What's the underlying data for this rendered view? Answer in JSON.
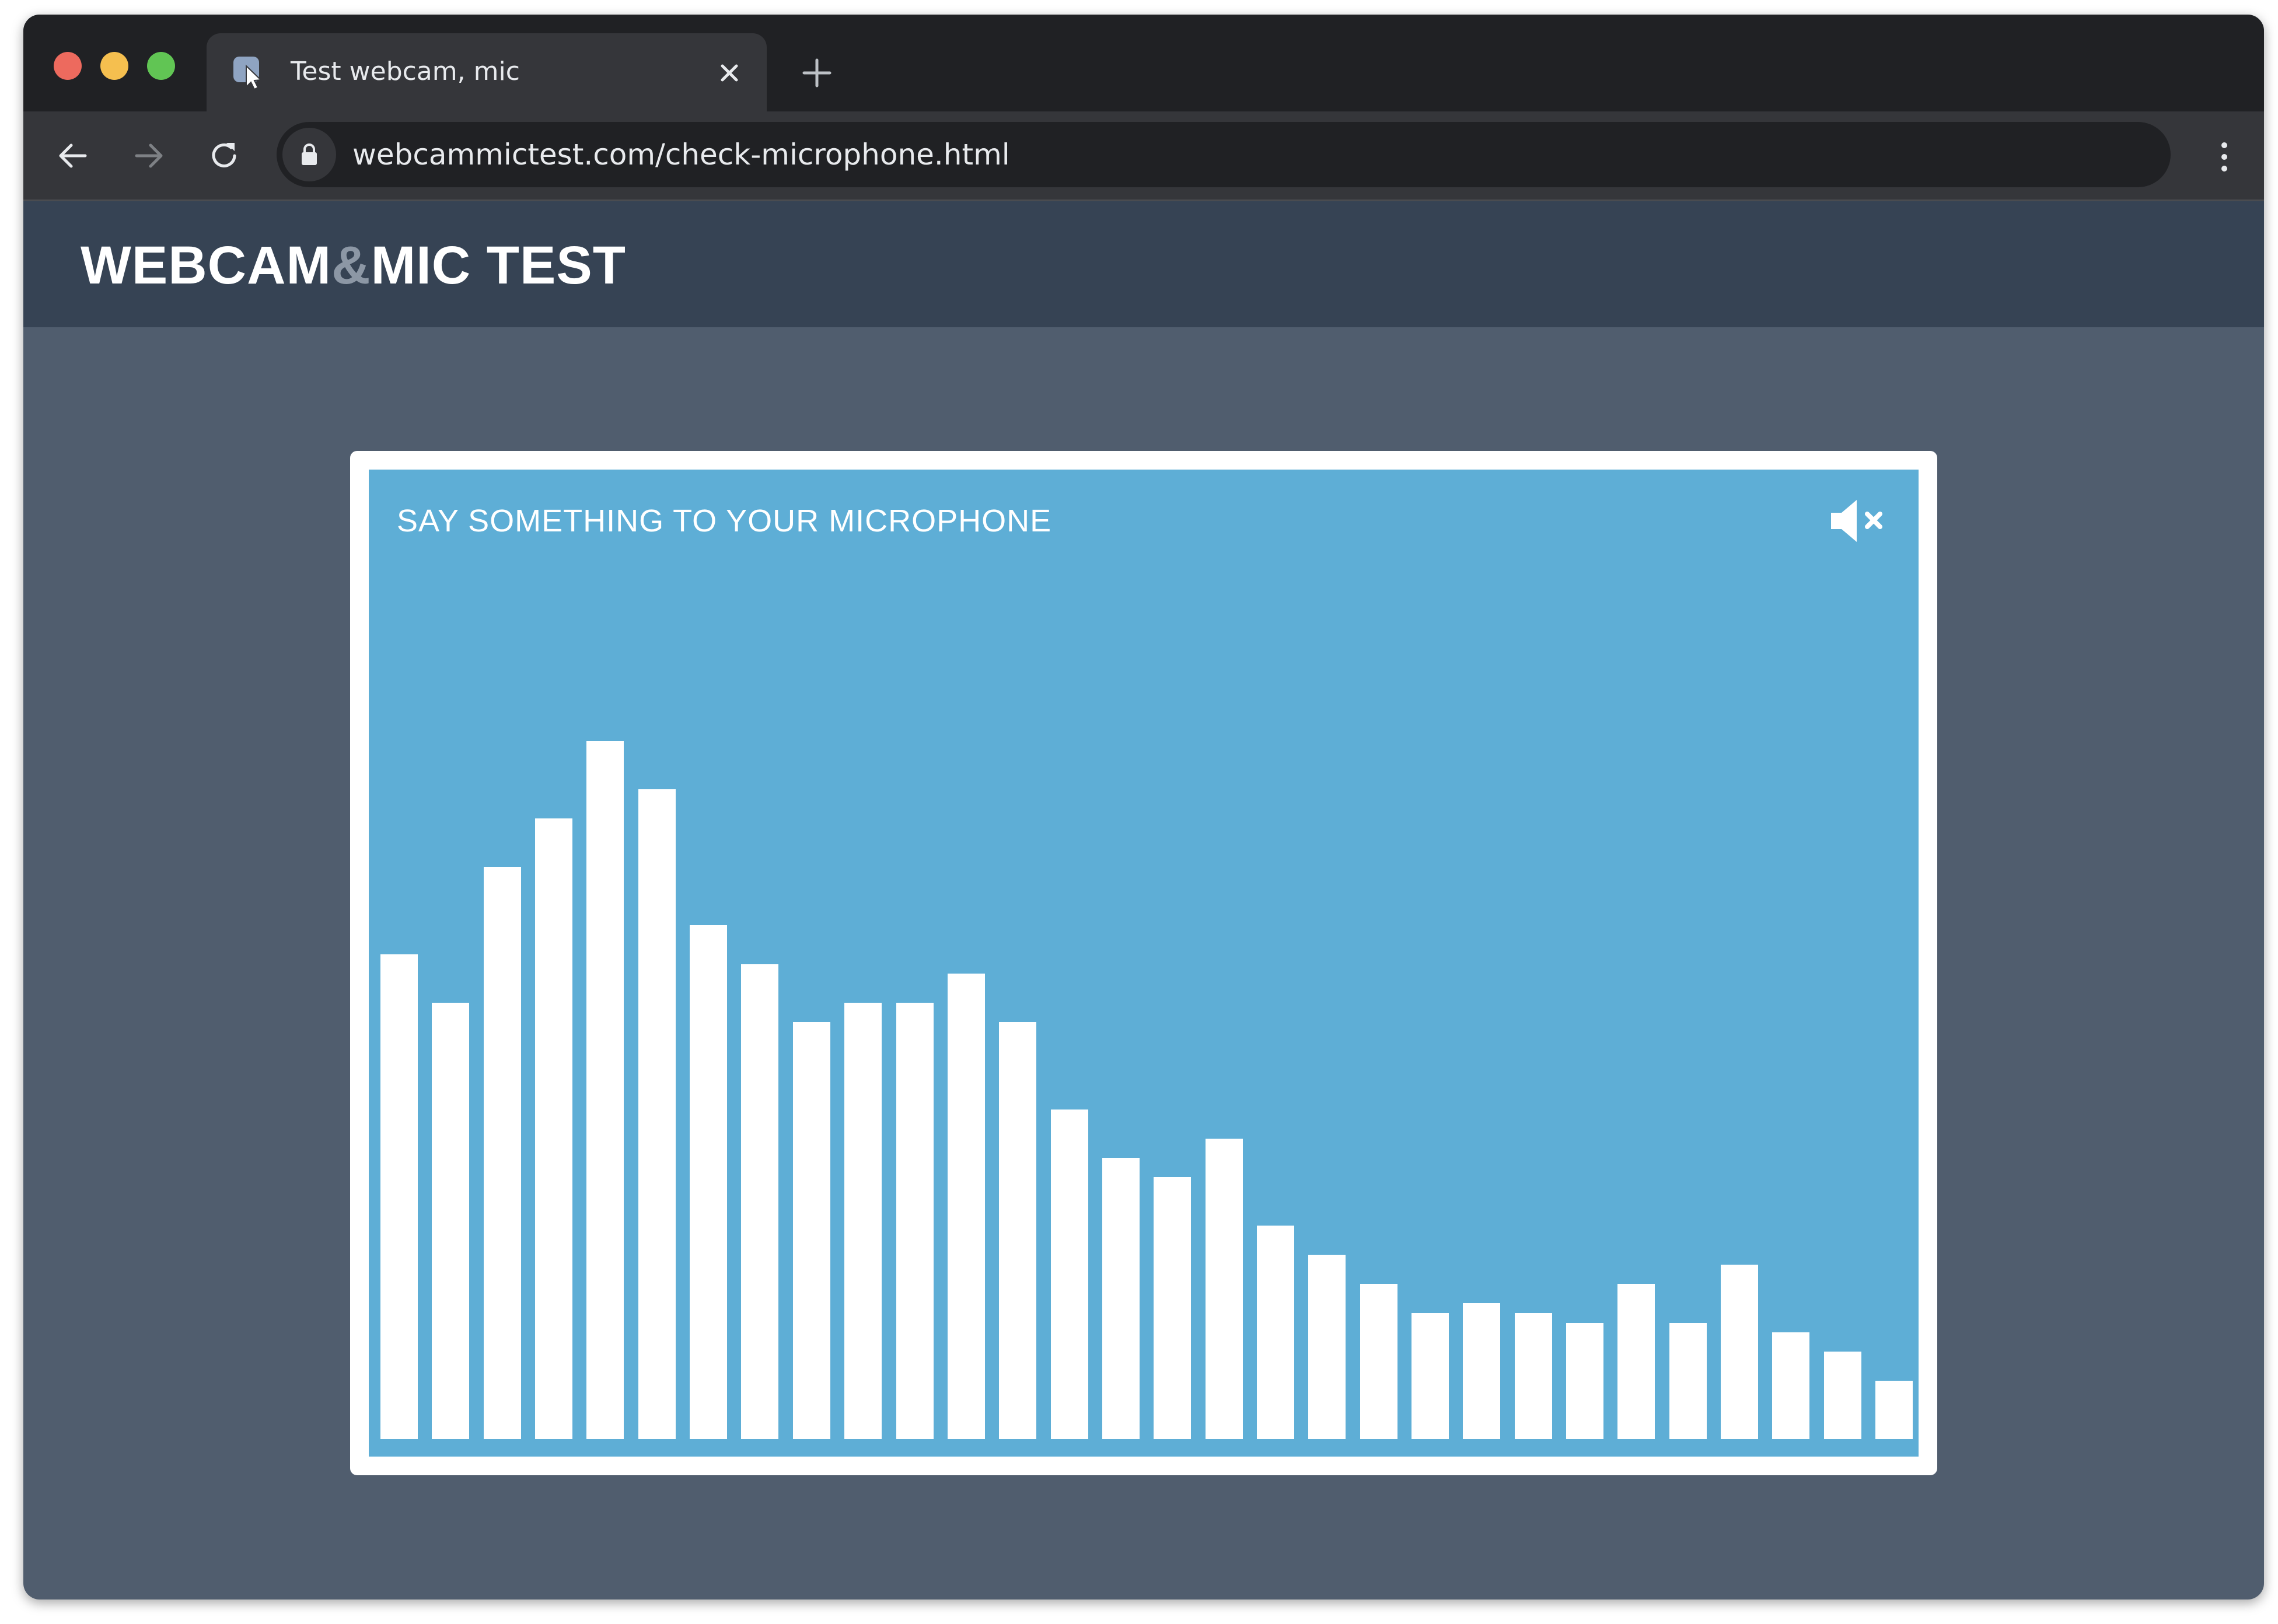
{
  "browser": {
    "tab_title": "Test webcam, mic",
    "url": "webcammictest.com/check-microphone.html",
    "icons": {
      "close": "close-icon",
      "new_tab": "plus-icon",
      "back": "arrow-left-icon",
      "forward": "arrow-right-icon",
      "reload": "reload-icon",
      "lock": "lock-icon",
      "menu": "more-vertical-icon"
    },
    "traffic_colors": [
      "#ed6a5e",
      "#f5bf4f",
      "#61c554"
    ]
  },
  "site": {
    "logo_part1": "WEBCAM",
    "logo_amp": "&",
    "logo_part2": "MIC TEST"
  },
  "mic_panel": {
    "title": "SAY SOMETHING TO YOUR MICROPHONE",
    "mute_icon": "speaker-muted-icon",
    "background": "#5eaed6",
    "bar_color": "#ffffff"
  },
  "chart_data": {
    "type": "bar",
    "values": [
      0.5,
      0.45,
      0.59,
      0.64,
      0.72,
      0.67,
      0.53,
      0.49,
      0.43,
      0.45,
      0.45,
      0.48,
      0.43,
      0.34,
      0.29,
      0.27,
      0.31,
      0.22,
      0.19,
      0.16,
      0.13,
      0.14,
      0.13,
      0.12,
      0.16,
      0.12,
      0.18,
      0.11,
      0.09,
      0.06
    ],
    "ylim": [
      0,
      1
    ]
  }
}
